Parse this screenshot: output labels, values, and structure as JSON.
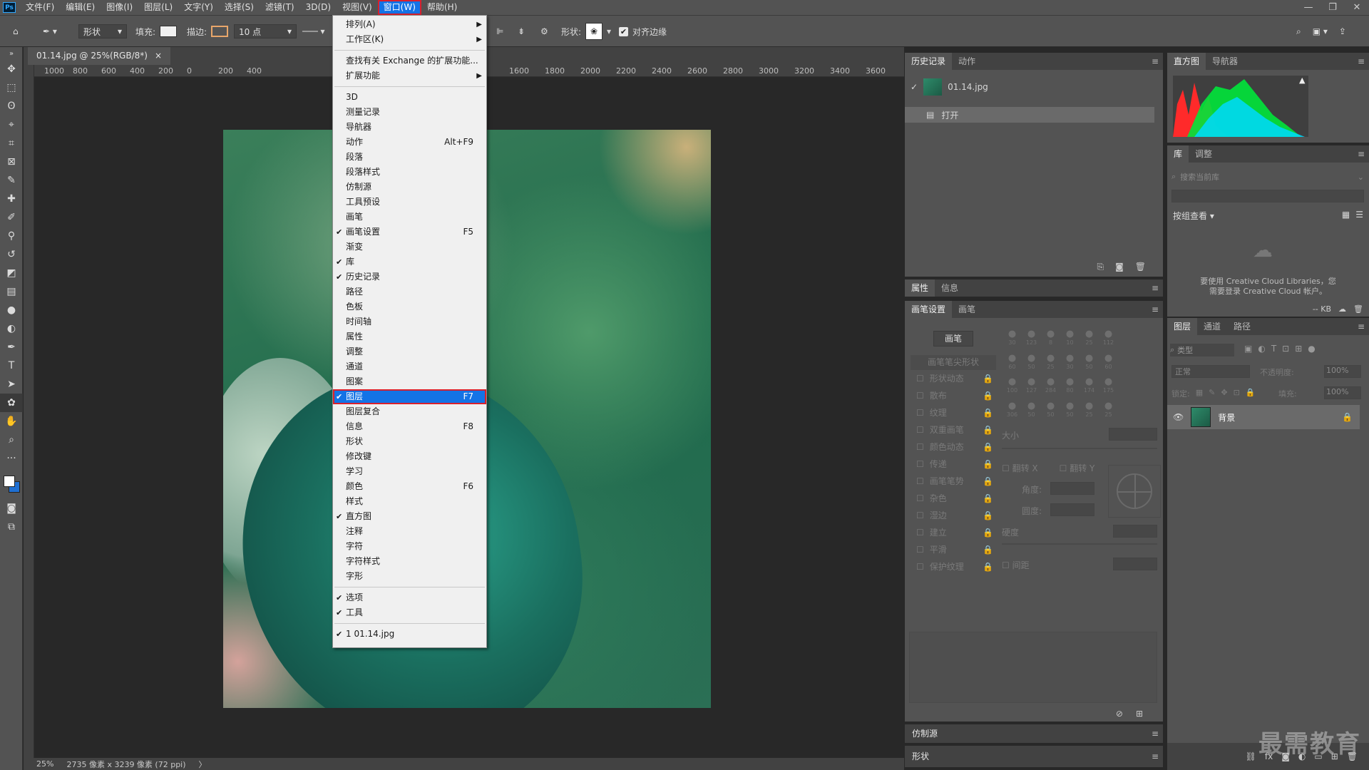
{
  "menubar": {
    "logo": "Ps",
    "items": [
      "文件(F)",
      "编辑(E)",
      "图像(I)",
      "图层(L)",
      "文字(Y)",
      "选择(S)",
      "滤镜(T)",
      "3D(D)",
      "视图(V)",
      "窗口(W)",
      "帮助(H)"
    ],
    "active_item": "窗口(W)",
    "window_buttons": [
      "—",
      "❐",
      "✕"
    ]
  },
  "options": {
    "shape_mode": "形状",
    "fill_label": "填充:",
    "stroke_label": "描边:",
    "stroke_width": "10 点",
    "shape_label": "形状:",
    "align_edges_label": "对齐边缘",
    "align_edges_checked": true
  },
  "document": {
    "tab_title": "01.14.jpg @ 25%(RGB/8*)",
    "tab_close": "×",
    "ruler_labels": [
      "1000",
      "800",
      "600",
      "400",
      "200",
      "0",
      "200",
      "400",
      "1600",
      "1800",
      "2000",
      "2200",
      "2400",
      "2600",
      "2800",
      "3000",
      "3200",
      "3400",
      "3600"
    ],
    "zoom": "25%",
    "size_info": "2735 像素 x 3239 像素 (72 ppi)",
    "status_arrow": "〉"
  },
  "window_menu": {
    "items": [
      {
        "label": "排列(A)",
        "submenu": true
      },
      {
        "label": "工作区(K)",
        "submenu": true
      },
      {
        "sep": true
      },
      {
        "label": "查找有关 Exchange 的扩展功能..."
      },
      {
        "label": "扩展功能",
        "submenu": true
      },
      {
        "sep": true
      },
      {
        "label": "3D"
      },
      {
        "label": "测量记录"
      },
      {
        "label": "导航器"
      },
      {
        "label": "动作",
        "shortcut": "Alt+F9"
      },
      {
        "label": "段落"
      },
      {
        "label": "段落样式"
      },
      {
        "label": "仿制源"
      },
      {
        "label": "工具预设"
      },
      {
        "label": "画笔"
      },
      {
        "label": "画笔设置",
        "shortcut": "F5",
        "checked": true
      },
      {
        "label": "渐变"
      },
      {
        "label": "库",
        "checked": true
      },
      {
        "label": "历史记录",
        "checked": true
      },
      {
        "label": "路径"
      },
      {
        "label": "色板"
      },
      {
        "label": "时间轴"
      },
      {
        "label": "属性"
      },
      {
        "label": "调整"
      },
      {
        "label": "通道"
      },
      {
        "label": "图案"
      },
      {
        "label": "图层",
        "shortcut": "F7",
        "checked": true,
        "highlighted": true
      },
      {
        "label": "图层复合"
      },
      {
        "label": "信息",
        "shortcut": "F8"
      },
      {
        "label": "形状"
      },
      {
        "label": "修改键"
      },
      {
        "label": "学习"
      },
      {
        "label": "颜色",
        "shortcut": "F6"
      },
      {
        "label": "样式"
      },
      {
        "label": "直方图",
        "checked": true
      },
      {
        "label": "注释"
      },
      {
        "label": "字符"
      },
      {
        "label": "字符样式"
      },
      {
        "label": "字形"
      },
      {
        "sep": true
      },
      {
        "label": "选项",
        "checked": true
      },
      {
        "label": "工具",
        "checked": true
      },
      {
        "sep": true
      },
      {
        "label": "1 01.14.jpg",
        "checked": true
      }
    ]
  },
  "history_panel": {
    "tabs": [
      "历史记录",
      "动作"
    ],
    "snapshot": "01.14.jpg",
    "state": "打开"
  },
  "histogram_panel": {
    "tabs": [
      "直方图",
      "导航器"
    ],
    "warning": "▲"
  },
  "library_panel": {
    "tabs": [
      "库",
      "调整"
    ],
    "search_placeholder": "搜索当前库",
    "group_by": "按组查看",
    "message_line1": "要使用 Creative Cloud Libraries，您",
    "message_line2": "需要登录 Creative Cloud 帐户。",
    "size": "-- KB"
  },
  "properties_panel": {
    "tabs": [
      "属性",
      "信息"
    ]
  },
  "brush_panel": {
    "tabs": [
      "画笔设置",
      "画笔"
    ],
    "brush_button": "画笔",
    "tip_shape": "画笔笔尖形状",
    "options": [
      "形状动态",
      "散布",
      "纹理",
      "双重画笔",
      "颜色动态",
      "传递",
      "画笔笔势",
      "杂色",
      "湿边",
      "建立",
      "平滑",
      "保护纹理"
    ],
    "size_label": "大小",
    "flip_x": "翻转 X",
    "flip_y": "翻转 Y",
    "angle_label": "角度:",
    "roundness_label": "圆度:",
    "hardness_label": "硬度",
    "spacing_label": "间距",
    "brush_sizes": [
      "30",
      "123",
      "8",
      "10",
      "25",
      "112",
      "60",
      "50",
      "25",
      "30",
      "50",
      "60",
      "100",
      "127",
      "284",
      "80",
      "174",
      "175",
      "306",
      "50",
      "50",
      "50",
      "25",
      "25"
    ]
  },
  "clone_panel": {
    "title": "仿制源"
  },
  "shape_panel": {
    "title": "形状"
  },
  "layers_panel": {
    "tabs": [
      "图层",
      "通道",
      "路径"
    ],
    "filter_kind": "类型",
    "blend_mode": "正常",
    "opacity_label": "不透明度:",
    "opacity": "100%",
    "lock_label": "锁定:",
    "fill_label": "填充:",
    "fill": "100%",
    "layer_name": "背景"
  },
  "watermark": "最需教育",
  "colors": {
    "accent": "#1473e6",
    "highlight_border": "#d9202c",
    "panel": "#535353",
    "panel_dark": "#424242",
    "canvas": "#282828"
  }
}
